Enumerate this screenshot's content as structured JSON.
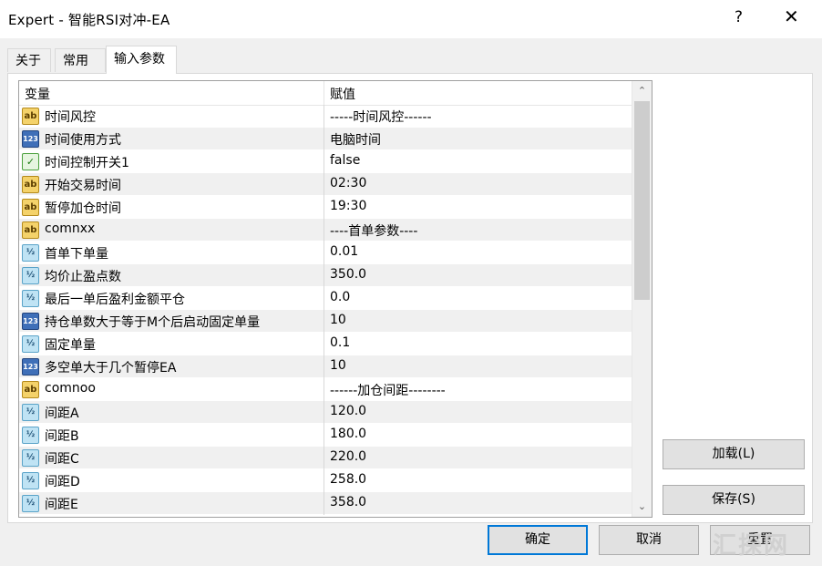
{
  "window": {
    "title": "Expert - 智能RSI对冲-EA",
    "help": "?",
    "close": "✕"
  },
  "tabs": [
    {
      "label": "关于"
    },
    {
      "label": "常用"
    },
    {
      "label": "输入参数"
    }
  ],
  "grid": {
    "col_variable": "变量",
    "col_value": "赋值",
    "rows": [
      {
        "icon": "ab",
        "name": "时间风控",
        "value": "-----时间风控------"
      },
      {
        "icon": "123",
        "name": "时间使用方式",
        "value": "电脑时间"
      },
      {
        "icon": "bool",
        "name": "时间控制开关1",
        "value": "false"
      },
      {
        "icon": "ab",
        "name": "开始交易时间",
        "value": "02:30"
      },
      {
        "icon": "ab",
        "name": "暂停加仓时间",
        "value": "19:30"
      },
      {
        "icon": "ab",
        "name": "comnxx",
        "value": "----首单参数----"
      },
      {
        "icon": "1/2",
        "name": "首单下单量",
        "value": "0.01"
      },
      {
        "icon": "1/2",
        "name": "均价止盈点数",
        "value": "350.0"
      },
      {
        "icon": "1/2",
        "name": "最后一单后盈利金额平仓",
        "value": "0.0"
      },
      {
        "icon": "123",
        "name": "持仓单数大于等于M个后启动固定单量",
        "value": "10"
      },
      {
        "icon": "1/2",
        "name": "固定单量",
        "value": "0.1"
      },
      {
        "icon": "123",
        "name": "多空单大于几个暂停EA",
        "value": "10"
      },
      {
        "icon": "ab",
        "name": "comnoo",
        "value": "------加仓间距--------"
      },
      {
        "icon": "1/2",
        "name": "间距A",
        "value": "120.0"
      },
      {
        "icon": "1/2",
        "name": "间距B",
        "value": "180.0"
      },
      {
        "icon": "1/2",
        "name": "间距C",
        "value": "220.0"
      },
      {
        "icon": "1/2",
        "name": "间距D",
        "value": "258.0"
      },
      {
        "icon": "1/2",
        "name": "间距E",
        "value": "358.0"
      }
    ]
  },
  "scrollbar": {
    "up": "⌃",
    "down": "⌄"
  },
  "buttons": {
    "load": "加载(L)",
    "save": "保存(S)",
    "ok": "确定",
    "cancel": "取消",
    "reset": "重置"
  },
  "watermark": "汇探网",
  "colors": {
    "default_button_border": "#0078d7",
    "alt_row": "#f0f0f0"
  }
}
